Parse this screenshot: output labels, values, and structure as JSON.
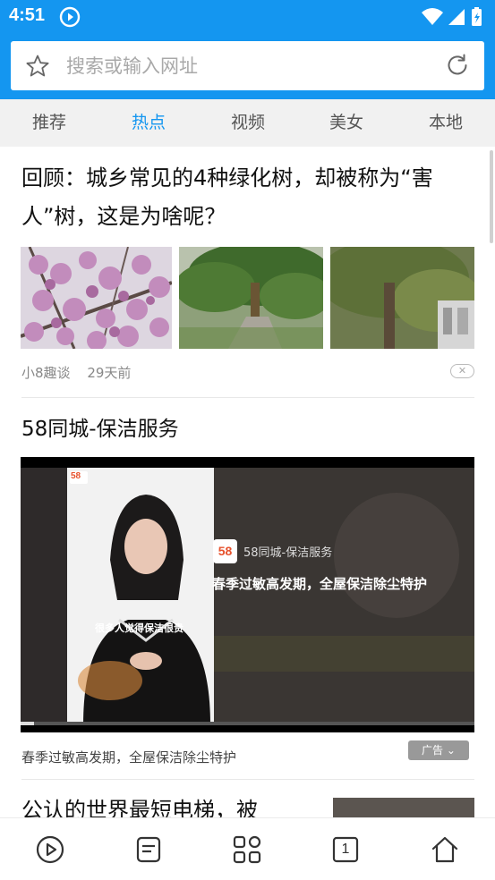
{
  "status_bar": {
    "time": "4:51",
    "color": "#1496f0"
  },
  "search": {
    "placeholder": "搜索或输入网址"
  },
  "tabs": [
    {
      "label": "推荐",
      "active": false
    },
    {
      "label": "热点",
      "active": true
    },
    {
      "label": "视频",
      "active": false
    },
    {
      "label": "美女",
      "active": false
    },
    {
      "label": "本地",
      "active": false
    }
  ],
  "feed": {
    "article1": {
      "title": "回顾：城乡常见的4种绿化树，却被称为“害人”树，这是为啥呢？",
      "source": "小8趣谈",
      "time": "29天前"
    },
    "ad": {
      "title": "58同城-保洁服务",
      "brand_logo": "58",
      "brand_name": "58同城-保洁服务",
      "overlay_text": "春季过敏高发期，全屋保洁除尘特护",
      "subtitle": "很多人觉得保洁很贵",
      "caption": "春季过敏高发期，全屋保洁除尘特护",
      "badge": "广告"
    },
    "article3": {
      "title": "公认的世界最短电梯，被"
    }
  },
  "bottom_nav": {
    "tab_count": "1"
  }
}
